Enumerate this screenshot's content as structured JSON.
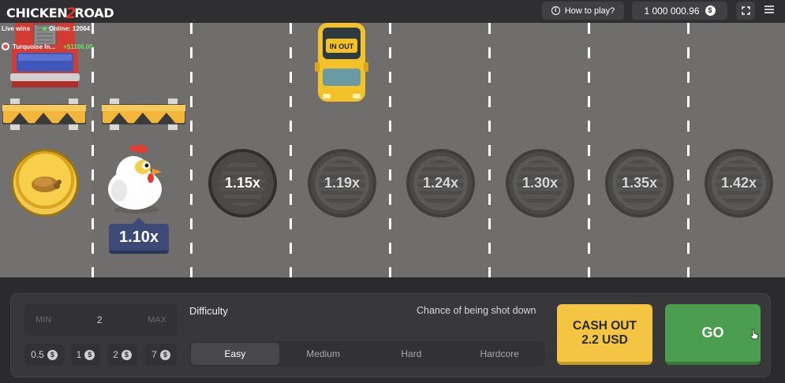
{
  "header": {
    "logo_left": "CHICKEN",
    "logo_mid": "2",
    "logo_right": "ROAD",
    "how_to_play": "How to play?",
    "balance": "1 000 000.96",
    "currency_symbol": "$"
  },
  "live": {
    "label": "Live wins",
    "online_label": "Online: 12064",
    "winner_name": "Turquoise In...",
    "winner_amount": "+$1106.00"
  },
  "road": {
    "car_brand": "IN OUT",
    "current_multiplier": "1.10x",
    "multipliers": [
      "1.15x",
      "1.19x",
      "1.24x",
      "1.30x",
      "1.35x",
      "1.42x"
    ]
  },
  "controls": {
    "min_label": "MIN",
    "max_label": "MAX",
    "bet_value": "2",
    "quick_bets": [
      "0.5",
      "1",
      "2",
      "7"
    ],
    "quick_bet_symbol": "$",
    "difficulty_label": "Difficulty",
    "chance_label": "Chance of being shot down",
    "difficulties": [
      "Easy",
      "Medium",
      "Hard",
      "Hardcore"
    ],
    "selected_difficulty": "Easy",
    "cashout_line1": "CASH OUT",
    "cashout_line2": "2.2 USD",
    "go_label": "GO"
  },
  "colors": {
    "road": "#6f6e6c",
    "panel": "#38383b",
    "cashout": "#f4c443",
    "go": "#4b9d4f",
    "multiplier_tag": "#3d4a78",
    "win_green": "#6ee26a"
  }
}
